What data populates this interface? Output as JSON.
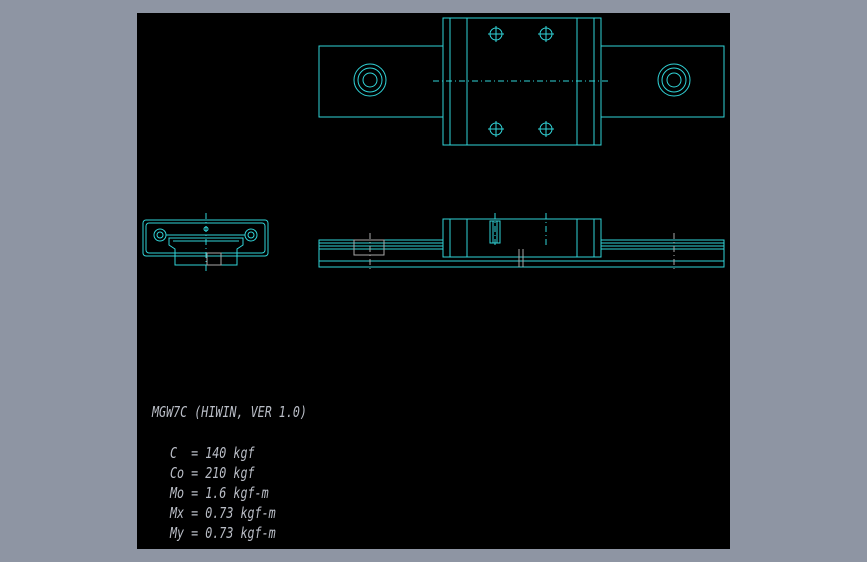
{
  "title": "MGW7C (HIWIN, VER 1.0)",
  "specs": [
    "C  = 140 kgf",
    "Co = 210 kgf",
    "Mo = 1.6 kgf-m",
    "Mx = 0.73 kgf-m",
    "My = 0.73 kgf-m"
  ],
  "colors": {
    "background": "#000000",
    "outer": "#8e95a3",
    "linework": "#31d4d8",
    "text": "#b9bdc6"
  }
}
